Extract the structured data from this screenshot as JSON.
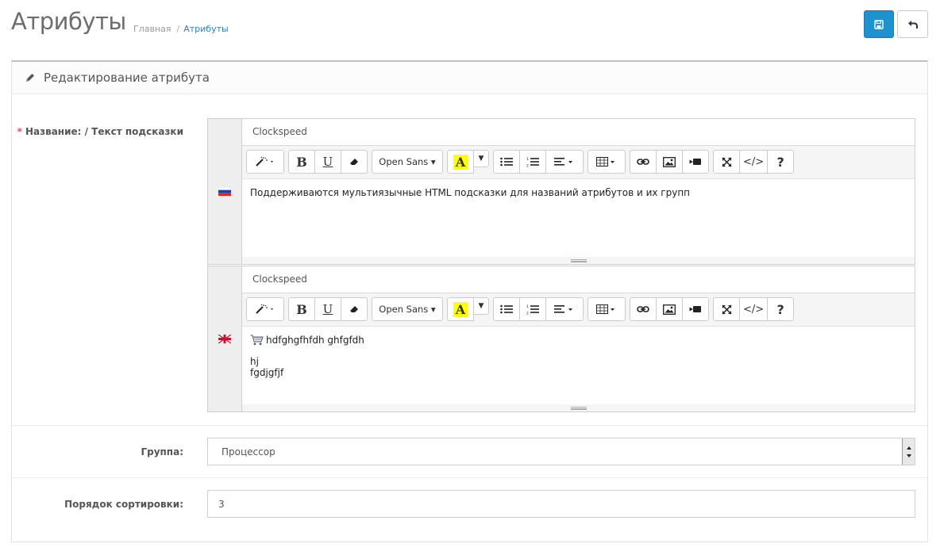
{
  "header": {
    "title": "Атрибуты",
    "breadcrumb": [
      "Главная",
      "Атрибуты"
    ],
    "save_icon": "save-icon",
    "back_icon": "reply-icon"
  },
  "panel": {
    "heading": "Редактирование атрибута",
    "heading_icon": "pencil-icon"
  },
  "form": {
    "name_label": "Название: / Текст подсказки",
    "required_mark": "*",
    "languages": [
      {
        "flag": "russian-flag",
        "name_value": "Clockspeed",
        "editor_content": [
          "Поддерживаются мультиязычные HTML подсказки для названий атрибутов и их групп"
        ]
      },
      {
        "flag": "uk-flag",
        "name_value": "Clockspeed",
        "editor_content": [
          "hdfghgfhfdh ghfgfdh",
          "hj",
          "fgdjgfjf"
        ]
      }
    ],
    "toolbar": {
      "font_name": "Open Sans",
      "color_letter": "A",
      "help": "?"
    },
    "group_label": "Группа:",
    "group_value": "Процессор",
    "sort_label": "Порядок сортировки:",
    "sort_value": "3"
  },
  "colors": {
    "primary": "#1e91cf",
    "required": "#d9534f",
    "highlight": "#ffff00"
  }
}
